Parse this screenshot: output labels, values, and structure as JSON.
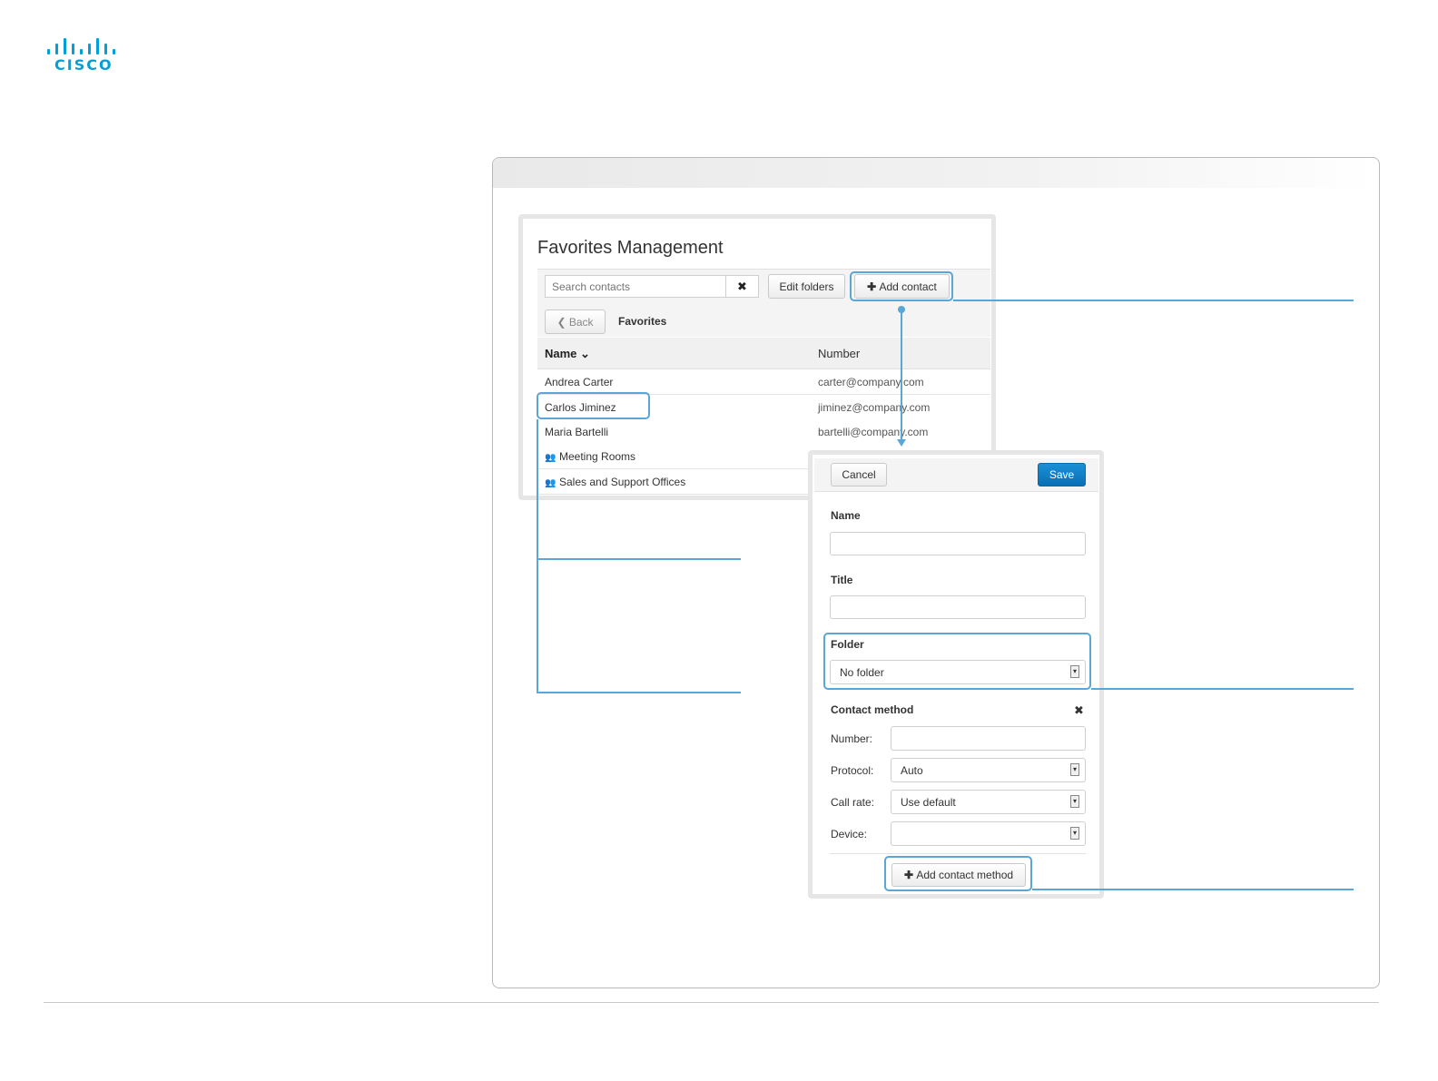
{
  "logo": {
    "wordmark": "CISCO",
    "brand_color": "#049fd9"
  },
  "favorites": {
    "title": "Favorites Management",
    "search_placeholder": "Search contacts",
    "clear_icon": "close-icon",
    "edit_folders_label": "Edit folders",
    "add_contact_label": "Add contact",
    "back_label": "Back",
    "breadcrumb": "Favorites",
    "columns": {
      "name": "Name",
      "number": "Number"
    },
    "rows": [
      {
        "name": "Andrea Carter",
        "number": "carter@company.com",
        "type": "contact"
      },
      {
        "name": "Carlos Jiminez",
        "number": "jiminez@company.com",
        "type": "contact"
      },
      {
        "name": "Maria Bartelli",
        "number": "bartelli@company.com",
        "type": "contact"
      },
      {
        "name": "Meeting Rooms",
        "number": "",
        "type": "folder"
      },
      {
        "name": "Sales and Support Offices",
        "number": "",
        "type": "folder"
      }
    ]
  },
  "dialog": {
    "cancel_label": "Cancel",
    "save_label": "Save",
    "save_color": "#0a75bd",
    "name_label": "Name",
    "title_label": "Title",
    "folder_label": "Folder",
    "folder_value": "No folder",
    "contact_method_label": "Contact method",
    "number_label": "Number:",
    "protocol_label": "Protocol:",
    "protocol_value": "Auto",
    "call_rate_label": "Call rate:",
    "call_rate_value": "Use default",
    "device_label": "Device:",
    "device_value": "",
    "add_method_label": "Add contact method"
  },
  "callout_color": "#5aa6d6"
}
